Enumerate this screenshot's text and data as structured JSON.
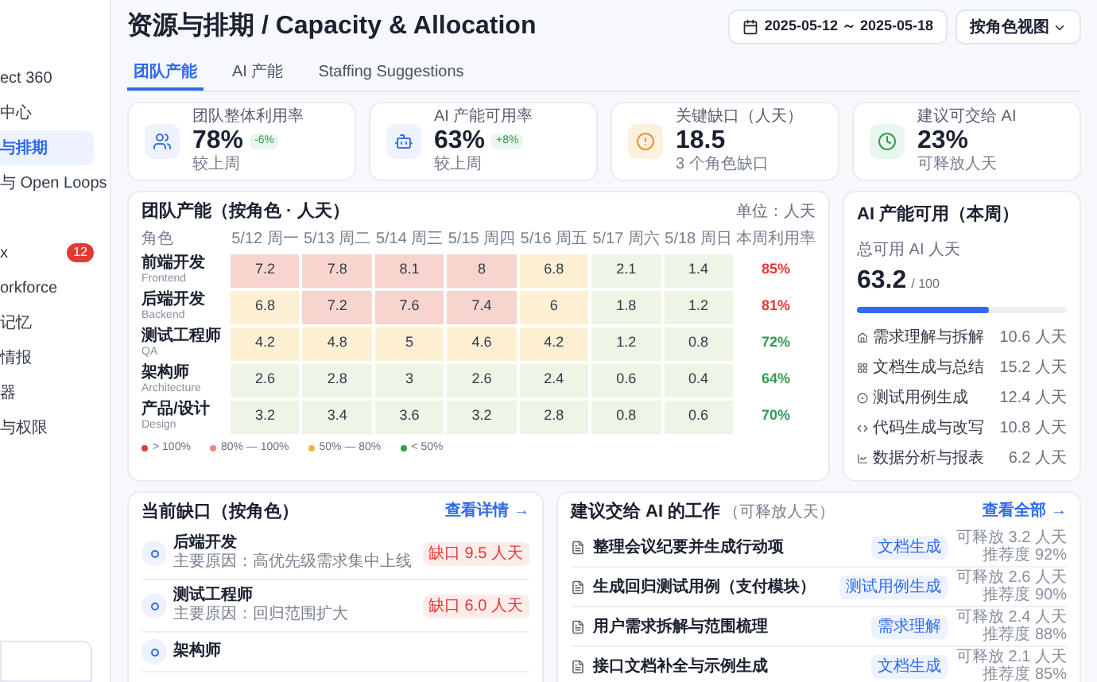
{
  "sidebar": {
    "items": [
      {
        "label": "ect 360",
        "selected": false
      },
      {
        "label": "中心",
        "selected": false
      },
      {
        "label": "与排期",
        "selected": true
      },
      {
        "label": "与 Open Loops",
        "selected": false
      },
      {
        "label": "x",
        "badge": "12",
        "selected": false
      },
      {
        "label": "orkforce",
        "selected": false
      },
      {
        "label": "记忆",
        "selected": false
      },
      {
        "label": "情报",
        "selected": false
      },
      {
        "label": "器",
        "selected": false
      },
      {
        "label": "与权限",
        "selected": false
      }
    ]
  },
  "header": {
    "title": "资源与排期 / Capacity & Allocation",
    "date_range": "2025-05-12 ～ 2025-05-18",
    "view_select": "按角色视图"
  },
  "tabs": [
    {
      "label": "团队产能",
      "selected": true
    },
    {
      "label": "AI 产能",
      "selected": false
    },
    {
      "label": "Staffing Suggestions",
      "selected": false
    }
  ],
  "kpis": [
    {
      "kind": "people",
      "label": "团队整体利用率",
      "value": "78%",
      "delta": "-6%",
      "note": "较上周"
    },
    {
      "kind": "robot",
      "label": "AI 产能可用率",
      "value": "63%",
      "delta": "+8%",
      "note": "较上周"
    },
    {
      "kind": "alert",
      "label": "关键缺口（人天）",
      "value": "18.5",
      "note": "3 个角色缺口"
    },
    {
      "kind": "clock",
      "label": "建议可交给 AI",
      "value": "23%",
      "note": "可释放人天"
    }
  ],
  "heatmap": {
    "title": "团队产能（按角色 · 人天）",
    "unit": "单位：人天",
    "role_header": "角色",
    "columns": [
      "5/12 周一",
      "5/13 周二",
      "5/14 周三",
      "5/15 周四",
      "5/16 周五",
      "5/17 周六",
      "5/18 周日"
    ],
    "utilization_header": "本周利用率",
    "rows": [
      {
        "role": "前端开发",
        "role_en": "Frontend",
        "cells": [
          {
            "value": "7.2",
            "color": "#f8d4cf"
          },
          {
            "value": "7.8",
            "color": "#f8d4cf"
          },
          {
            "value": "8.1",
            "color": "#f8d4cf"
          },
          {
            "value": "8",
            "color": "#f8d4cf"
          },
          {
            "value": "6.8",
            "color": "#fdf0d2"
          },
          {
            "value": "2.1",
            "color": "#eef4e6"
          },
          {
            "value": "1.4",
            "color": "#eef4e6"
          }
        ],
        "utilization": "85%",
        "color": "#e53935"
      },
      {
        "role": "后端开发",
        "role_en": "Backend",
        "cells": [
          {
            "value": "6.8",
            "color": "#fdf0d2"
          },
          {
            "value": "7.2",
            "color": "#f8d4cf"
          },
          {
            "value": "7.6",
            "color": "#f8d4cf"
          },
          {
            "value": "7.4",
            "color": "#f8d4cf"
          },
          {
            "value": "6",
            "color": "#fdf0d2"
          },
          {
            "value": "1.8",
            "color": "#eef4e6"
          },
          {
            "value": "1.2",
            "color": "#eef4e6"
          }
        ],
        "utilization": "81%",
        "color": "#e53935"
      },
      {
        "role": "测试工程师",
        "role_en": "QA",
        "cells": [
          {
            "value": "4.2",
            "color": "#fdf0d2"
          },
          {
            "value": "4.8",
            "color": "#fdf0d2"
          },
          {
            "value": "5",
            "color": "#fdf0d2"
          },
          {
            "value": "4.6",
            "color": "#fdf0d2"
          },
          {
            "value": "4.2",
            "color": "#fdf0d2"
          },
          {
            "value": "1.2",
            "color": "#eef4e6"
          },
          {
            "value": "0.8",
            "color": "#eef4e6"
          }
        ],
        "utilization": "72%",
        "color": "#2e9e4f"
      },
      {
        "role": "架构师",
        "role_en": "Architecture",
        "cells": [
          {
            "value": "2.6",
            "color": "#eef4e6"
          },
          {
            "value": "2.8",
            "color": "#eef4e6"
          },
          {
            "value": "3",
            "color": "#eef4e6"
          },
          {
            "value": "2.6",
            "color": "#eef4e6"
          },
          {
            "value": "2.4",
            "color": "#eef4e6"
          },
          {
            "value": "0.6",
            "color": "#eef4e6"
          },
          {
            "value": "0.4",
            "color": "#eef4e6"
          }
        ],
        "utilization": "64%",
        "color": "#2e9e4f"
      },
      {
        "role": "产品/设计",
        "role_en": "Design",
        "cells": [
          {
            "value": "3.2",
            "color": "#eef4e6"
          },
          {
            "value": "3.4",
            "color": "#eef4e6"
          },
          {
            "value": "3.6",
            "color": "#eef4e6"
          },
          {
            "value": "3.2",
            "color": "#eef4e6"
          },
          {
            "value": "2.8",
            "color": "#eef4e6"
          },
          {
            "value": "0.8",
            "color": "#eef4e6"
          },
          {
            "value": "0.6",
            "color": "#eef4e6"
          }
        ],
        "utilization": "70%",
        "color": "#2e9e4f"
      }
    ],
    "legend": [
      {
        "label": "> 100%",
        "color": "#e53935"
      },
      {
        "label": "80% — 100%",
        "color": "#f08a7e"
      },
      {
        "label": "50% — 80%",
        "color": "#f5b041"
      },
      {
        "label": "< 50%",
        "color": "#2e9e4f"
      }
    ]
  },
  "ai_capacity": {
    "title": "AI 产能可用（本周）",
    "label": "总可用 AI 人天",
    "value": "63.2",
    "total": "/ 100",
    "level": 0.632,
    "items": [
      {
        "kind": "home",
        "name": "需求理解与拆解",
        "value": "10.6 人天"
      },
      {
        "kind": "grid",
        "name": "文档生成与总结",
        "value": "15.2 人天"
      },
      {
        "kind": "circle",
        "name": "测试用例生成",
        "value": "12.4 人天"
      },
      {
        "kind": "code",
        "name": "代码生成与改写",
        "value": "10.8 人天"
      },
      {
        "kind": "chart",
        "name": "数据分析与报表",
        "value": "6.2 人天"
      }
    ]
  },
  "shortages": {
    "title": "当前缺口（按角色）",
    "link": "查看详情 →",
    "items": [
      {
        "role": "后端开发",
        "reason": "主要原因：高优先级需求集中上线",
        "gap": "缺口 9.5 人天"
      },
      {
        "role": "测试工程师",
        "reason": "主要原因：回归范围扩大",
        "gap": "缺口 6.0 人天"
      },
      {
        "role": "架构师"
      }
    ]
  },
  "ai_work": {
    "title": "建议交给 AI 的工作",
    "subtitle": "（可释放人天）",
    "link": "查看全部 →",
    "items": [
      {
        "task": "整理会议纪要并生成行动项",
        "tag": "文档生成",
        "release": "可释放 3.2 人天",
        "score": "推荐度 92%"
      },
      {
        "task": "生成回归测试用例（支付模块）",
        "tag": "测试用例生成",
        "release": "可释放 2.6 人天",
        "score": "推荐度 90%"
      },
      {
        "task": "用户需求拆解与范围梳理",
        "tag": "需求理解",
        "release": "可释放 2.4 人天",
        "score": "推荐度 88%"
      },
      {
        "task": "接口文档补全与示例生成",
        "tag": "文档生成",
        "release": "可释放 2.1 人天",
        "score": "推荐度 85%"
      }
    ]
  }
}
